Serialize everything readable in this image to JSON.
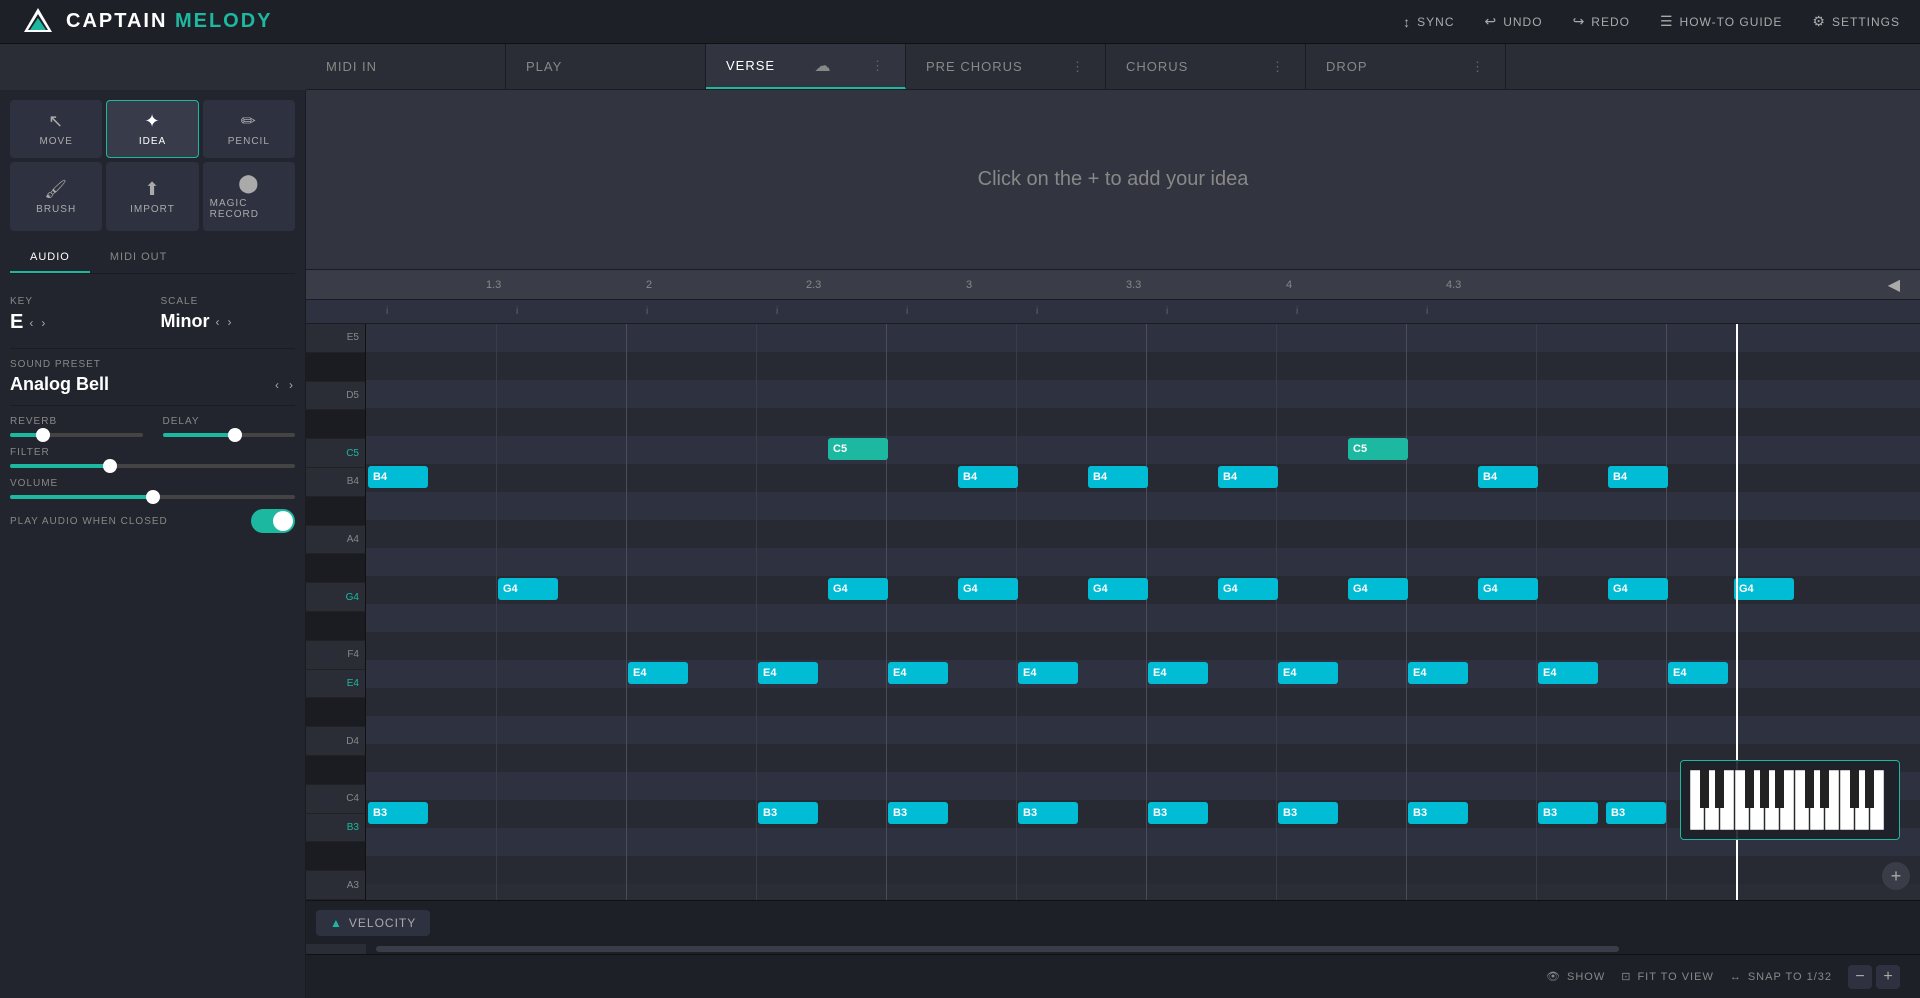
{
  "app": {
    "name_captain": "CAPTAIN",
    "name_melody": "MELODY"
  },
  "header": {
    "sync_label": "SYNC",
    "undo_label": "UNDO",
    "redo_label": "REDO",
    "how_to_guide_label": "HOW-TO GUIDE",
    "settings_label": "SETTINGS"
  },
  "tabbar": {
    "tabs": [
      {
        "id": "midi-in",
        "label": "MIDI IN",
        "active": false
      },
      {
        "id": "play",
        "label": "PLAY",
        "active": false
      },
      {
        "id": "verse",
        "label": "VERSE",
        "active": true
      },
      {
        "id": "pre-chorus",
        "label": "PRE CHORUS",
        "active": false
      },
      {
        "id": "chorus",
        "label": "CHORUS",
        "active": false
      },
      {
        "id": "drop",
        "label": "DROP",
        "active": false
      }
    ]
  },
  "left_panel": {
    "tools": [
      {
        "id": "move",
        "label": "MOVE",
        "icon": "⬆",
        "active": false
      },
      {
        "id": "idea",
        "label": "IDEA",
        "icon": "✏",
        "active": true
      },
      {
        "id": "pencil",
        "label": "PENCIL",
        "icon": "✏",
        "active": false
      },
      {
        "id": "brush",
        "label": "BRUSH",
        "icon": "🖌",
        "active": false
      },
      {
        "id": "import",
        "label": "IMPORT",
        "icon": "⬆",
        "active": false
      },
      {
        "id": "magic-record",
        "label": "MAGIC RECORD",
        "icon": "●",
        "active": false
      }
    ],
    "audio_tab": "AUDIO",
    "midi_out_tab": "MIDI OUT",
    "key_label": "KEY",
    "key_value": "E",
    "scale_label": "SCALE",
    "scale_value": "Minor",
    "sound_preset_label": "SOUND PRESET",
    "sound_preset_value": "Analog Bell",
    "reverb_label": "REVERB",
    "reverb_value": 25,
    "delay_label": "DELAY",
    "delay_value": 55,
    "filter_label": "FILTER",
    "filter_value": 35,
    "volume_label": "VOLUME",
    "volume_value": 50,
    "play_audio_label": "PLAY AUDIO WHEN CLOSED",
    "play_audio_enabled": true
  },
  "chorus_empty": {
    "message": "Click on the + to add your idea"
  },
  "timeline": {
    "markers": [
      "1.3",
      "2",
      "2.3",
      "3",
      "3.3",
      "4",
      "4.3"
    ]
  },
  "notes": {
    "rows": [
      "E5",
      "E4"
    ],
    "items": [
      {
        "id": "n1",
        "pitch": "B4",
        "col": 0,
        "color": "cyan"
      },
      {
        "id": "n2",
        "pitch": "C5",
        "col": 1,
        "color": "green"
      },
      {
        "id": "n3",
        "pitch": "G4",
        "col": 1,
        "color": "cyan"
      },
      {
        "id": "n4",
        "pitch": "E4",
        "col": 1,
        "color": "cyan"
      },
      {
        "id": "n5",
        "pitch": "B3",
        "col": 0,
        "color": "cyan"
      },
      {
        "id": "n6",
        "pitch": "B4",
        "col": 2,
        "color": "cyan"
      },
      {
        "id": "n7",
        "pitch": "G4",
        "col": 2,
        "color": "cyan"
      },
      {
        "id": "n8",
        "pitch": "E4",
        "col": 2,
        "color": "cyan"
      },
      {
        "id": "n9",
        "pitch": "B3",
        "col": 2,
        "color": "cyan"
      },
      {
        "id": "n10",
        "pitch": "B4",
        "col": 3,
        "color": "cyan"
      },
      {
        "id": "n11",
        "pitch": "G4",
        "col": 3,
        "color": "cyan"
      },
      {
        "id": "n12",
        "pitch": "E4",
        "col": 3,
        "color": "cyan"
      },
      {
        "id": "n13",
        "pitch": "B3",
        "col": 3,
        "color": "cyan"
      },
      {
        "id": "n14",
        "pitch": "B4",
        "col": 4,
        "color": "cyan"
      },
      {
        "id": "n15",
        "pitch": "C5",
        "col": 4,
        "color": "green"
      },
      {
        "id": "n16",
        "pitch": "G4",
        "col": 4,
        "color": "cyan"
      },
      {
        "id": "n17",
        "pitch": "E4",
        "col": 4,
        "color": "cyan"
      },
      {
        "id": "n18",
        "pitch": "B3",
        "col": 4,
        "color": "cyan"
      },
      {
        "id": "n19",
        "pitch": "B4",
        "col": 5,
        "color": "cyan"
      },
      {
        "id": "n20",
        "pitch": "G4",
        "col": 5,
        "color": "cyan"
      },
      {
        "id": "n21",
        "pitch": "E4",
        "col": 5,
        "color": "cyan"
      },
      {
        "id": "n22",
        "pitch": "B3",
        "col": 5,
        "color": "cyan"
      },
      {
        "id": "n23",
        "pitch": "B4",
        "col": 6,
        "color": "cyan"
      },
      {
        "id": "n24",
        "pitch": "G4",
        "col": 6,
        "color": "cyan"
      },
      {
        "id": "n25",
        "pitch": "E4",
        "col": 6,
        "color": "cyan"
      },
      {
        "id": "n26",
        "pitch": "B3",
        "col": 6,
        "color": "cyan"
      },
      {
        "id": "n27",
        "pitch": "B4",
        "col": 7,
        "color": "cyan"
      },
      {
        "id": "n28",
        "pitch": "G4",
        "col": 7,
        "color": "cyan"
      },
      {
        "id": "n29",
        "pitch": "E4",
        "col": 7,
        "color": "cyan"
      },
      {
        "id": "n30",
        "pitch": "B3",
        "col": 7,
        "color": "cyan"
      }
    ]
  },
  "bottom_bar": {
    "show_label": "SHOW",
    "fit_to_view_label": "FIT TO VIEW",
    "snap_label": "SNAP TO 1/32",
    "zoom_minus": "−",
    "zoom_plus": "+"
  },
  "velocity": {
    "label": "VELOCITY"
  }
}
